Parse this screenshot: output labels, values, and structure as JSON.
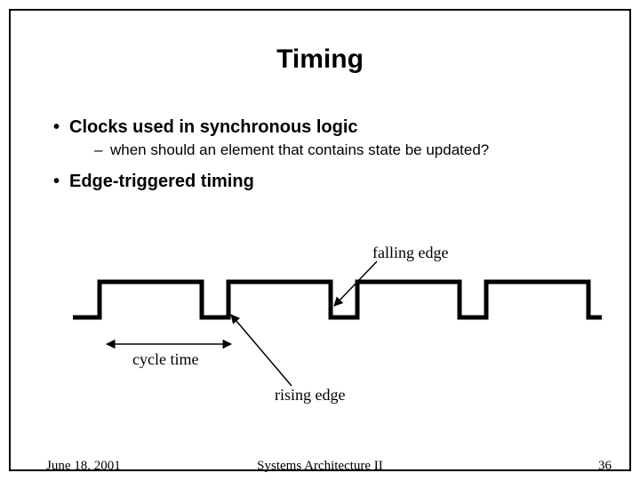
{
  "title": "Timing",
  "bullets": {
    "b1a": "Clocks used in synchronous logic",
    "b2a": "when should an element that contains state be updated?",
    "b1b": "Edge-triggered timing"
  },
  "labels": {
    "falling_edge": "falling edge",
    "rising_edge": "rising edge",
    "cycle_time": "cycle time"
  },
  "footer": {
    "date": "June 18, 2001",
    "course": "Systems Architecture II",
    "page": "36"
  }
}
